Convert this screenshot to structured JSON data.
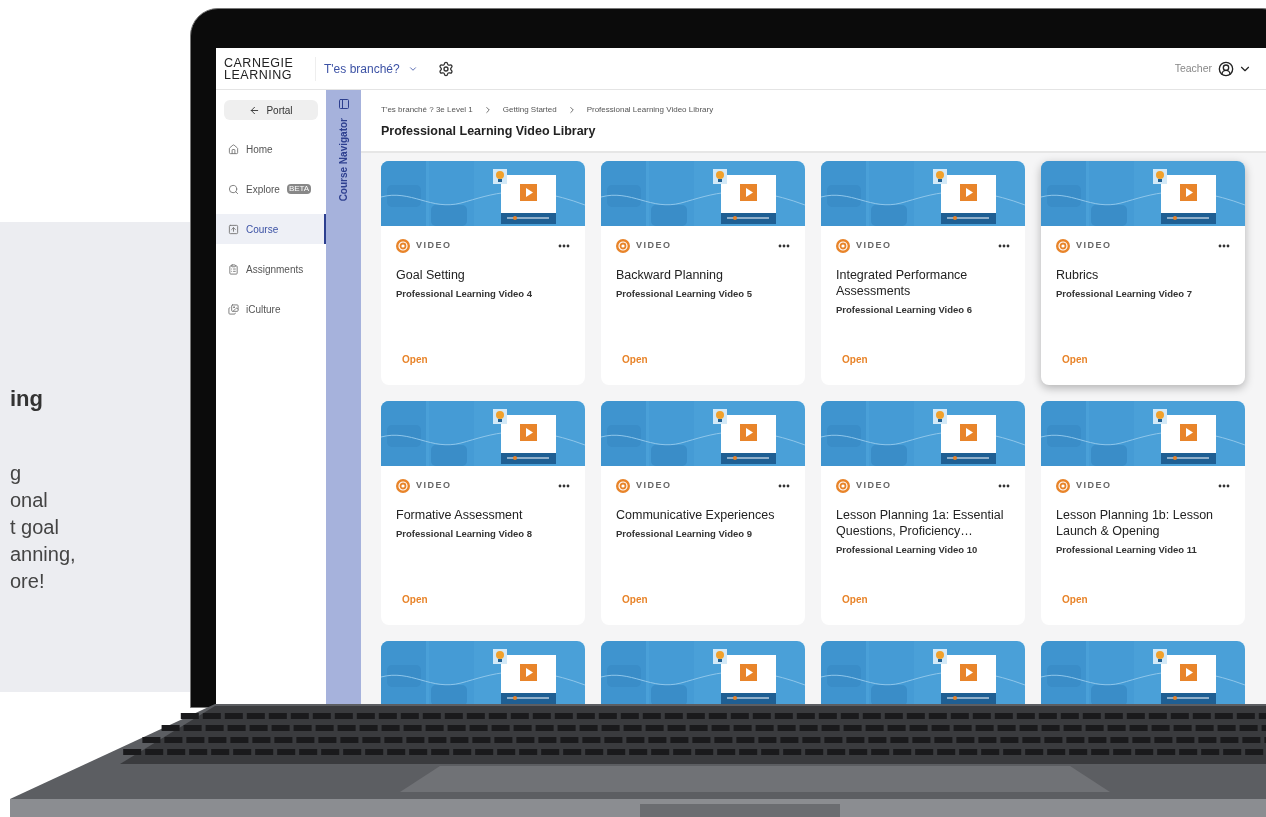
{
  "promo": {
    "heading": "ing",
    "lines": [
      "g",
      "onal",
      "t goal",
      "anning,",
      "ore!"
    ]
  },
  "header": {
    "logo_lines": [
      "CARNEGIE",
      "LEARNING"
    ],
    "course_picker": "T'es branché?",
    "user_role": "Teacher"
  },
  "sidebar": {
    "back_button": "Portal",
    "items": [
      {
        "label": "Home",
        "selected": false
      },
      {
        "label": "Explore",
        "badge": "BETA",
        "selected": false
      },
      {
        "label": "Course",
        "selected": true
      },
      {
        "label": "Assignments",
        "selected": false
      },
      {
        "label": "iCulture",
        "selected": false
      }
    ]
  },
  "navigator": {
    "label": "Course Navigator"
  },
  "breadcrumb": [
    "T'es branché ? 3e Level 1",
    "Getting Started",
    "Professional Learning Video Library"
  ],
  "page_title": "Professional Learning Video Library",
  "cards": [
    {
      "kind": "video",
      "type_label": "VIDEO",
      "title": "Goal Setting",
      "subtitle": "Professional Learning Video 4",
      "action": "Open",
      "hovered": false
    },
    {
      "kind": "video",
      "type_label": "VIDEO",
      "title": "Backward Planning",
      "subtitle": "Professional Learning Video 5",
      "action": "Open",
      "hovered": false
    },
    {
      "kind": "video",
      "type_label": "VIDEO",
      "title": "Integrated Performance Assessments",
      "subtitle": "Professional Learning Video 6",
      "action": "Open",
      "hovered": false
    },
    {
      "kind": "video",
      "type_label": "VIDEO",
      "title": "Rubrics",
      "subtitle": "Professional Learning Video 7",
      "action": "Open",
      "hovered": true
    },
    {
      "kind": "video",
      "type_label": "VIDEO",
      "title": "Formative Assessment",
      "subtitle": "Professional Learning Video 8",
      "action": "Open",
      "hovered": false
    },
    {
      "kind": "video",
      "type_label": "VIDEO",
      "title": "Communicative Experiences",
      "subtitle": "Professional Learning Video 9",
      "action": "Open",
      "hovered": false
    },
    {
      "kind": "video",
      "type_label": "VIDEO",
      "title": "Lesson Planning 1a: Essential Questions, Proficiency…",
      "subtitle": "Professional Learning Video 10",
      "action": "Open",
      "hovered": false
    },
    {
      "kind": "video",
      "type_label": "VIDEO",
      "title": "Lesson Planning 1b: Lesson Launch & Opening",
      "subtitle": "Professional Learning Video 11",
      "action": "Open",
      "hovered": false
    },
    {
      "kind": "thumbnail"
    },
    {
      "kind": "thumbnail"
    },
    {
      "kind": "thumbnail"
    },
    {
      "kind": "thumbnail"
    }
  ]
}
